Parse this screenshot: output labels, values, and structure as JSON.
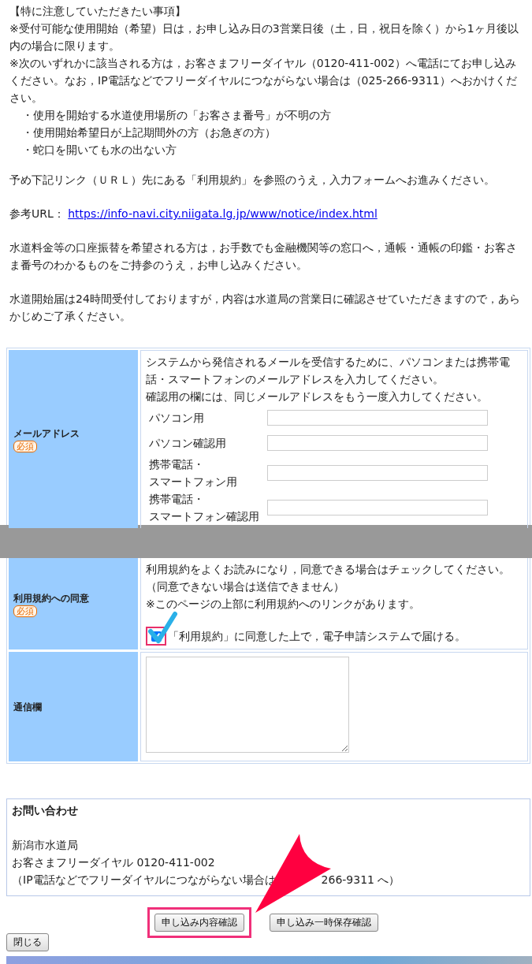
{
  "notice": {
    "heading": "【特に注意していただきたい事項】",
    "paragraphs": [
      "※受付可能な使用開始（希望）日は，お申し込み日の3営業日後（土，日，祝日を除く）から1ヶ月後以内の場合に限ります。",
      "※次のいずれかに該当される方は，お客さまフリーダイヤル（0120-411-002）へ電話にてお申し込みください。なお，IP電話などでフリーダイヤルにつながらない場合は（025-266-9311）へおかけください。"
    ],
    "bullets": [
      "・使用を開始する水道使用場所の「お客さま番号」が不明の方",
      "・使用開始希望日が上記期間外の方（お急ぎの方）",
      "・蛇口を開いても水の出ない方"
    ]
  },
  "intro": "予め下記リンク（ＵＲＬ）先にある「利用規約」を参照のうえ，入力フォームへお進みください。",
  "reference": {
    "label": "参考URL：",
    "url": "https://info-navi.city.niigata.lg.jp/www/notice/index.html"
  },
  "paragraphs": [
    "水道料金等の口座振替を希望される方は，お手数でも金融機関等の窓口へ，通帳・通帳の印鑑・お客さま番号のわかるものをご持参のうえ，お申し込みください。",
    "水道開始届は24時間受付しておりますが，内容は水道局の営業日に確認させていただきますので，あらかじめご了承ください。"
  ],
  "email_section": {
    "label": "メールアドレス",
    "required": "必須",
    "description": [
      "システムから発信されるメールを受信するために、パソコンまたは携帯電話・スマートフォンのメールアドレスを入力してください。",
      "確認用の欄には、同じメールアドレスをもう一度入力してください。"
    ],
    "fields": [
      {
        "label": "パソコン用"
      },
      {
        "label": "パソコン確認用"
      },
      {
        "label": "携帯電話・",
        "label_line_2": "スマートフォン用"
      },
      {
        "label": "携帯電話・",
        "label_line_2": "スマートフォン確認用"
      }
    ]
  },
  "agreement": {
    "label": "利用規約への同意",
    "required": "必須",
    "description": [
      "利用規約をよくお読みになり，同意できる場合はチェックしてください。",
      "（同意できない場合は送信できません）",
      "※このページの上部に利用規約へのリンクがあります。"
    ],
    "checkbox_label": "「利用規約」に同意した上で，電子申請システムで届ける。",
    "checked": true
  },
  "comments": {
    "label": "通信欄"
  },
  "inquiry": {
    "title": "お問い合わせ",
    "lines": [
      "新潟市水道局",
      "お客さまフリーダイヤル 0120-411-002"
    ],
    "covered_line": [
      "（IP電話などでフリーダイヤルにつながらない場合は",
      "266-9311 へ）"
    ]
  },
  "buttons": [
    {
      "label": "申し込み内容確認",
      "highlighted": true
    },
    {
      "label": "申し込み一時保存確認",
      "highlighted": false
    }
  ],
  "close_button": "閉じる"
}
